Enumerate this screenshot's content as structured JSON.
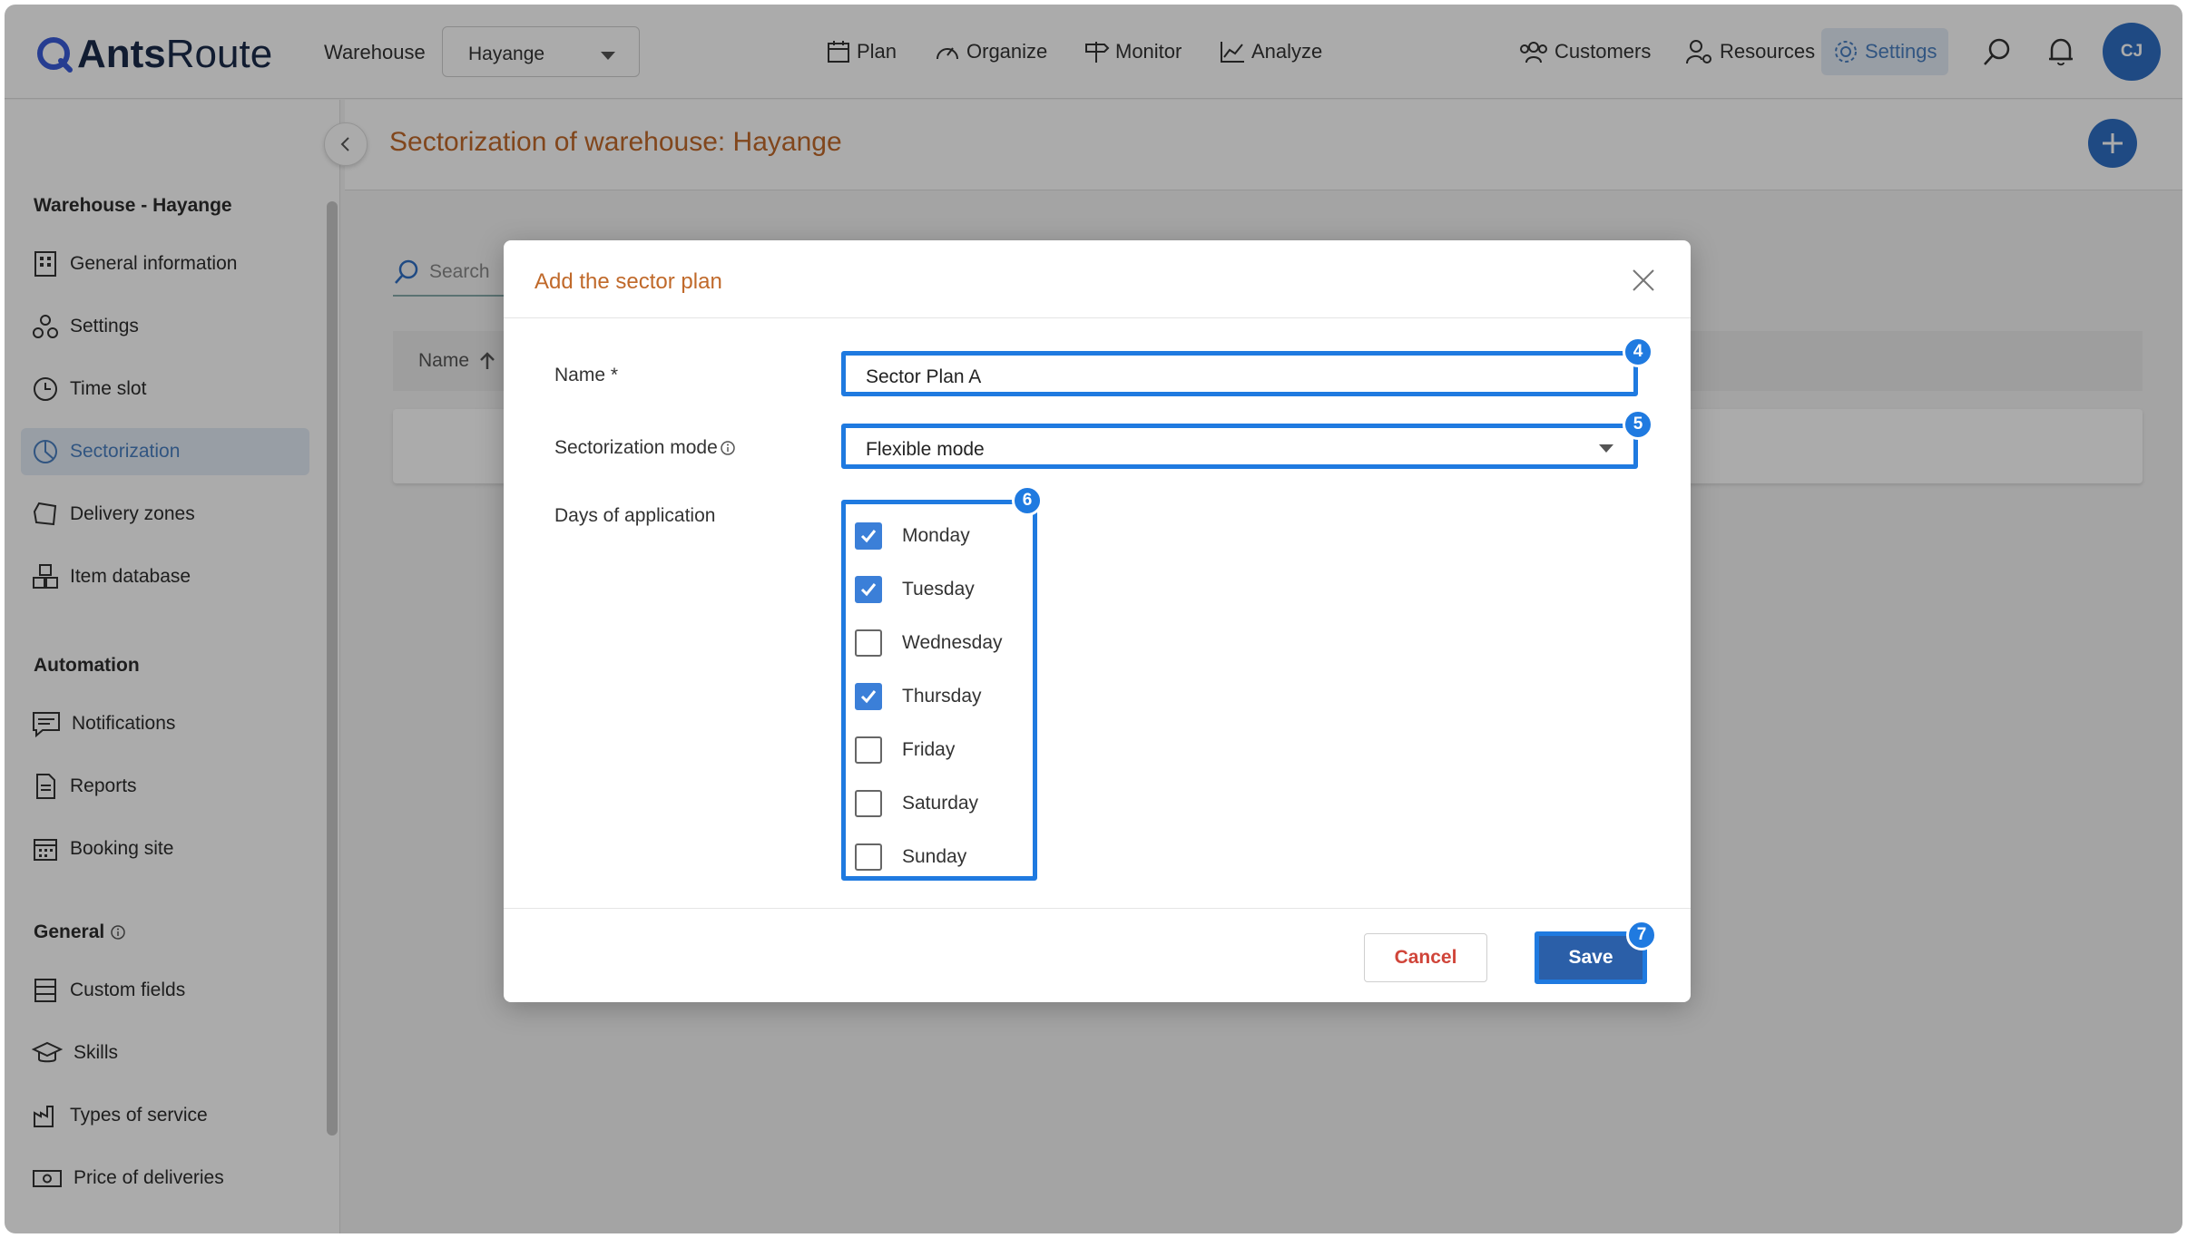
{
  "app": {
    "logo_bold": "Ants",
    "logo_rest": "Route",
    "warehouse_label": "Warehouse",
    "warehouse_value": "Hayange",
    "nav": [
      "Plan",
      "Organize",
      "Monitor",
      "Analyze"
    ],
    "right_nav": [
      "Customers",
      "Resources",
      "Settings"
    ],
    "avatar_initials": "CJ"
  },
  "sidebar": {
    "section_warehouse": "Warehouse - Hayange",
    "warehouse_items": [
      "General information",
      "Settings",
      "Time slot",
      "Sectorization",
      "Delivery zones",
      "Item database"
    ],
    "section_automation": "Automation",
    "automation_items": [
      "Notifications",
      "Reports",
      "Booking site"
    ],
    "section_general": "General",
    "general_items": [
      "Custom fields",
      "Skills",
      "Types of service",
      "Price of deliveries"
    ]
  },
  "main": {
    "title": "Sectorization of warehouse: Hayange",
    "search_placeholder": "Search",
    "column_name": "Name"
  },
  "modal": {
    "title": "Add the sector plan",
    "name_label": "Name *",
    "name_value": "Sector Plan A",
    "mode_label": "Sectorization mode",
    "mode_value": "Flexible mode",
    "days_label": "Days of application",
    "days": [
      {
        "label": "Monday",
        "checked": true
      },
      {
        "label": "Tuesday",
        "checked": true
      },
      {
        "label": "Wednesday",
        "checked": false
      },
      {
        "label": "Thursday",
        "checked": true
      },
      {
        "label": "Friday",
        "checked": false
      },
      {
        "label": "Saturday",
        "checked": false
      },
      {
        "label": "Sunday",
        "checked": false
      }
    ],
    "cancel_label": "Cancel",
    "save_label": "Save",
    "step_badges": [
      "4",
      "5",
      "6",
      "7"
    ]
  },
  "colors": {
    "accent": "#2f6fc4",
    "title_orange": "#c0692a",
    "highlight_blue": "#1f7ae0",
    "cancel_red": "#d0453a"
  }
}
